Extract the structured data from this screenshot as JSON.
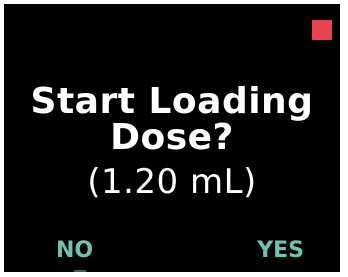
{
  "screen": {
    "background_color": "#000000",
    "status_indicator": {
      "icon": "red-square-icon",
      "color": "#e8434f"
    },
    "prompt": {
      "title_line1": "Start Loading",
      "title_line2": "Dose?",
      "volume_text": "(1.20 mL)"
    },
    "softkeys": {
      "left_label": "NO",
      "right_label": "YES",
      "color": "#6fc3ad"
    }
  }
}
